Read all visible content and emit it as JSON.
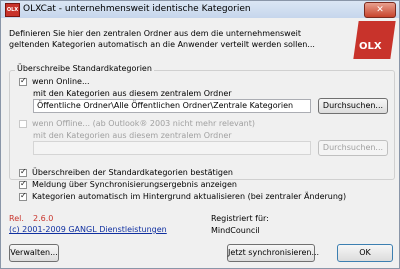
{
  "window": {
    "title": "OLXCat - unternehmensweit identische Kategorien",
    "close_label": "✕",
    "app_icon_text": "OLX"
  },
  "intro_text": "Definieren Sie hier den zentralen Ordner aus dem die unternehmensweit geltenden Kategorien automatisch an die Anwender verteilt werden sollen...",
  "logo_text": "OLX",
  "group": {
    "legend": "Überschreibe Standardkategorien",
    "online": {
      "checkbox_label": "wenn Online...",
      "path_label": "mit den Kategorien aus diesem zentralem Ordner",
      "path_value": "Öffentliche Ordner\\Alle Öffentlichen Ordner\\Zentrale Kategorien",
      "browse_label": "Durchsuchen..."
    },
    "offline": {
      "checkbox_label": "wenn Offline... (ab Outlook® 2003 nicht mehr relevant)",
      "path_label": "mit den Kategorien aus diesem zentralem Ordner",
      "path_value": "",
      "browse_label": "Durchsuchen..."
    }
  },
  "options": [
    "Überschreiben der Standardkategorien bestätigen",
    "Meldung über Synchronisierungsergebnis anzeigen",
    "Kategorien automatisch im Hintergrund aktualisieren (bei zentraler Änderung)"
  ],
  "release": {
    "label": "Rel.",
    "value": "2.6.0"
  },
  "copyright": "(c) 2001-2009 GANGL Dienstleistungen",
  "registration": {
    "label": "Registriert für:",
    "value": "MindCouncil"
  },
  "buttons": {
    "manage": "Verwalten...",
    "sync_now": "Jetzt synchronisieren...",
    "ok": "OK"
  },
  "colors": {
    "accent_red": "#c8332b",
    "link_blue": "#1030a0"
  }
}
